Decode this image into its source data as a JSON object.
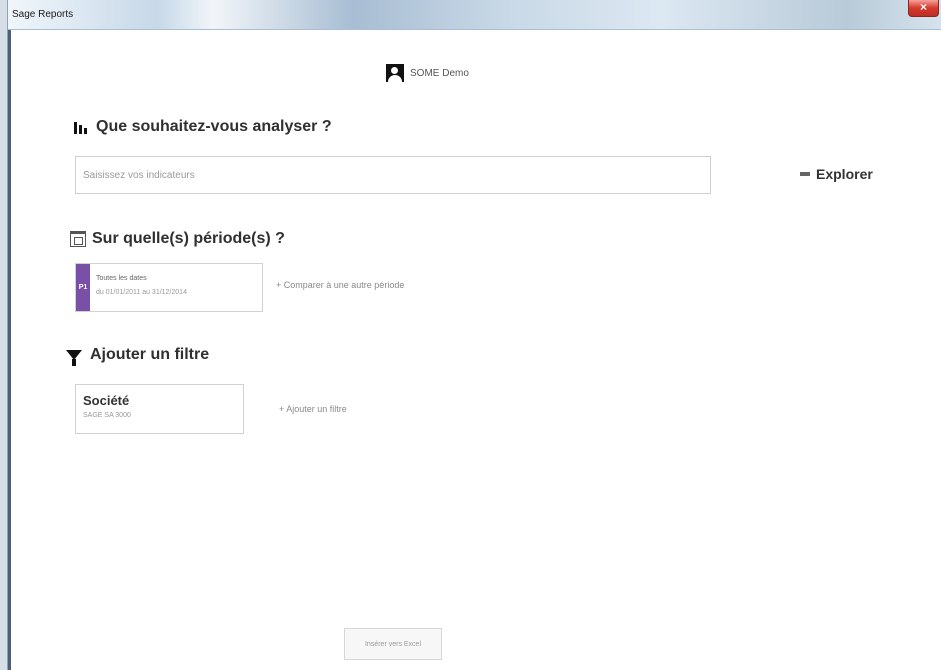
{
  "window": {
    "title": "Sage Reports",
    "close_symbol": "×"
  },
  "user": {
    "name": "SOME Demo",
    "avatar_icon": "user-avatar-icon"
  },
  "sections": {
    "analysis": {
      "icon": "bar-chart-icon",
      "title": "Que souhaitez-vous analyser ?"
    },
    "period": {
      "icon": "calendar-icon",
      "title": "Sur quelle(s) période(s) ?"
    },
    "filter": {
      "icon": "filter-icon",
      "title": "Ajouter un filtre"
    }
  },
  "indicators": {
    "placeholder": "Saisissez vos indicateurs",
    "value": ""
  },
  "actions": {
    "explorer_label": "Explorer",
    "compare_period": "+ Comparer à une autre période",
    "add_filter": "+ Ajouter un filtre",
    "bottom_button": "Insérer vers Excel"
  },
  "period_card": {
    "badge": "P1",
    "label": "Toutes les dates",
    "range": "du 01/01/2011 au 31/12/2014",
    "accent_color": "#7a4fa8"
  },
  "filter_card": {
    "title": "Société",
    "value": "SAGE SA 3000"
  }
}
